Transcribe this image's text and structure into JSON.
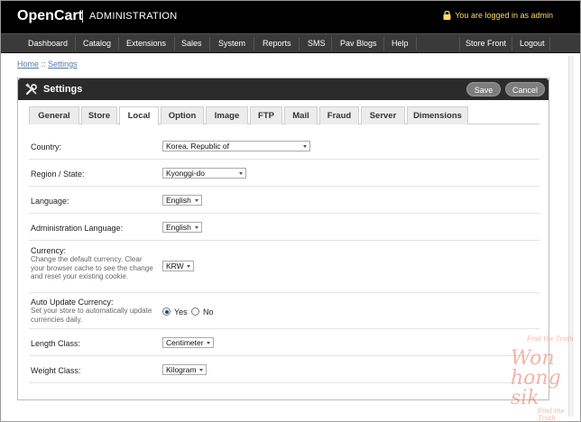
{
  "header": {
    "logo": "OpenCart",
    "section": "ADMINISTRATION",
    "logged_in": "You are logged in as admin"
  },
  "nav": {
    "left": [
      "Dashboard",
      "Catalog",
      "Extensions",
      "Sales",
      "System",
      "Reports",
      "SMS",
      "Pav Blogs",
      "Help"
    ],
    "right": [
      "Store Front",
      "Logout"
    ]
  },
  "breadcrumb": {
    "home": "Home",
    "separator": "::",
    "current": "Settings"
  },
  "panel": {
    "title": "Settings",
    "save": "Save",
    "cancel": "Cancel"
  },
  "tabs": [
    "General",
    "Store",
    "Local",
    "Option",
    "Image",
    "FTP",
    "Mail",
    "Fraud",
    "Server",
    "Dimensions"
  ],
  "active_tab": "Local",
  "form": {
    "country": {
      "label": "Country:",
      "value": "Korea, Republic of"
    },
    "region": {
      "label": "Region / State:",
      "value": "Kyonggi-do"
    },
    "language": {
      "label": "Language:",
      "value": "English"
    },
    "admin_language": {
      "label": "Administration Language:",
      "value": "English"
    },
    "currency": {
      "label": "Currency:",
      "help": "Change the default currency. Clear your browser cache to see the change and reset your existing cookie.",
      "value": "KRW"
    },
    "auto_update": {
      "label": "Auto Update Currency:",
      "help": "Set your store to automatically update currencies daily.",
      "yes": "Yes",
      "no": "No",
      "selected": "Yes"
    },
    "length_class": {
      "label": "Length Class:",
      "value": "Centimeter"
    },
    "weight_class": {
      "label": "Weight Class:",
      "value": "Kilogram"
    }
  },
  "watermark": {
    "line1": "Find the Truth",
    "line2": "Won",
    "line3": "hong",
    "line4": "sik",
    "line5": "Find the Truth"
  },
  "colors": {
    "header_bg": "#000000",
    "nav_bg": "#3a3a3a",
    "panel_head": "#2b2b2b",
    "link": "#5a78a6",
    "lock": "#ffd966"
  }
}
